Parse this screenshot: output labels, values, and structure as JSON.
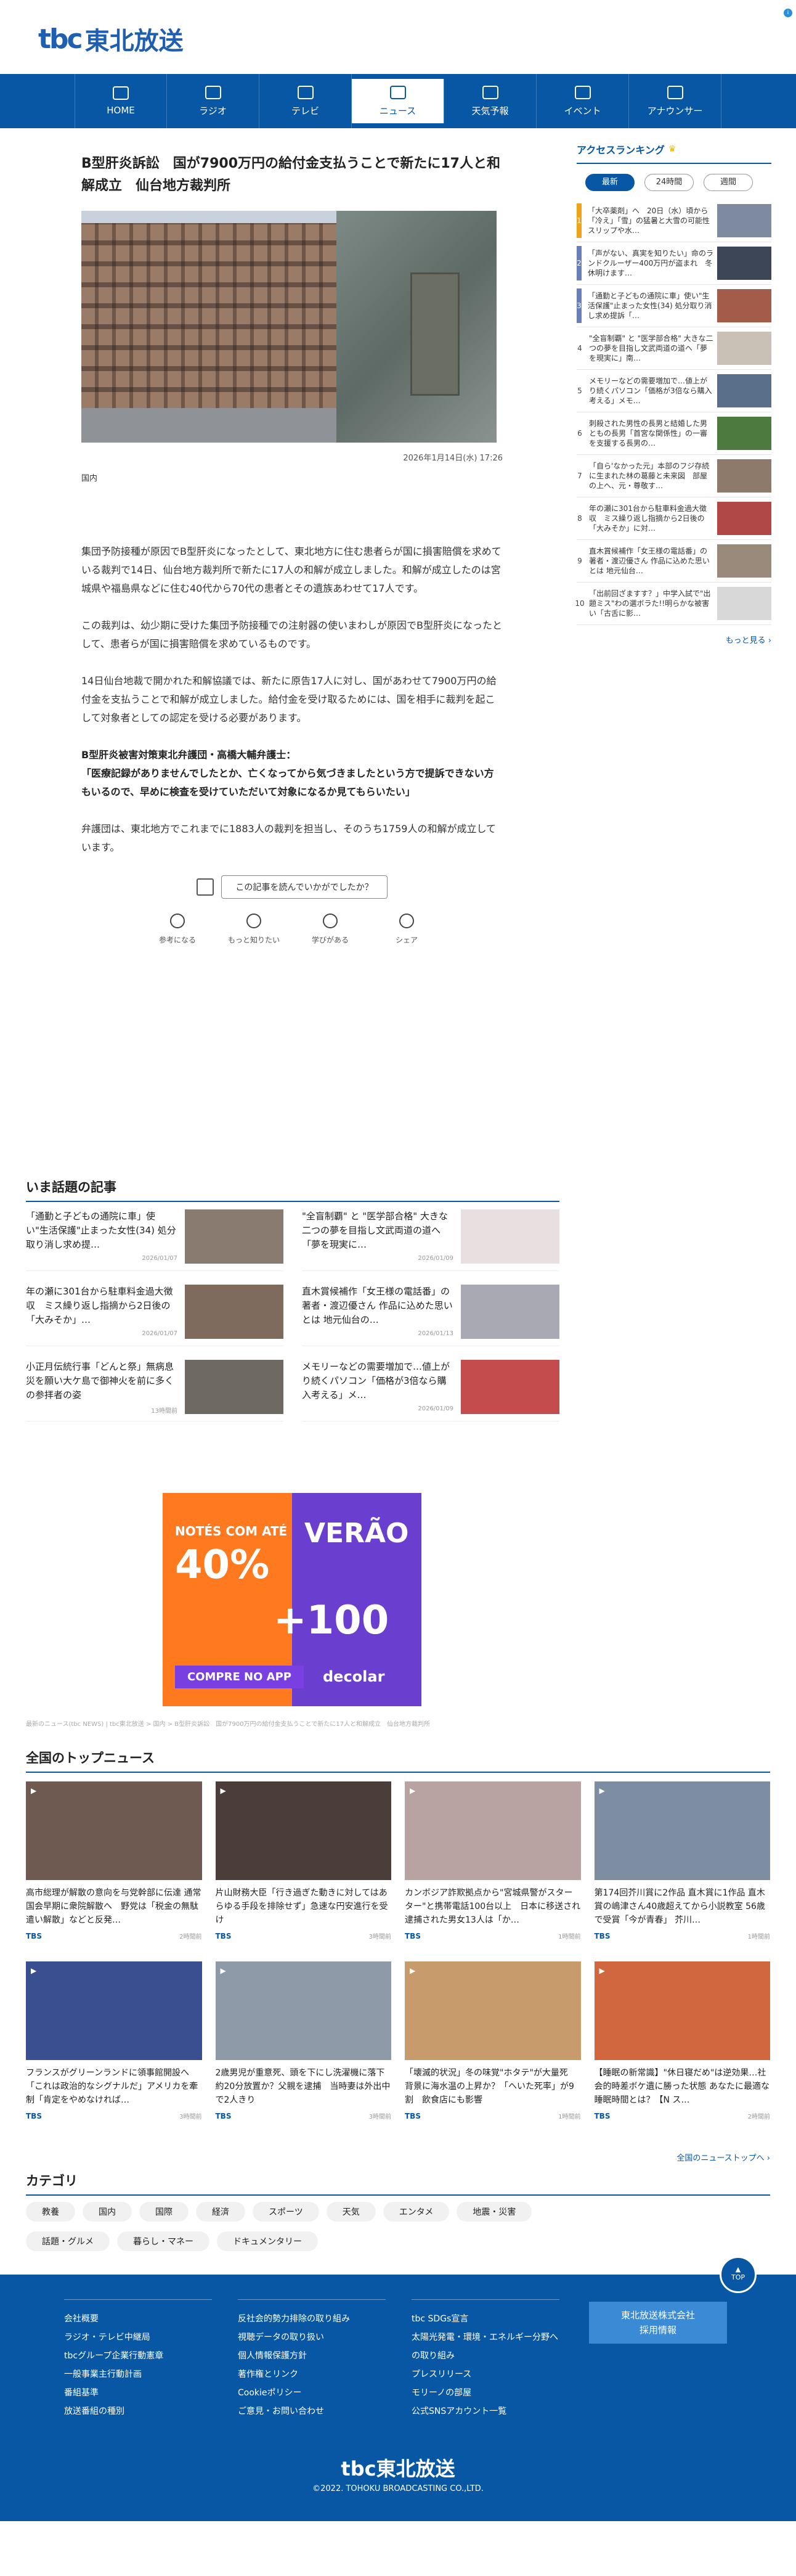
{
  "site": {
    "logo_mark": "tbc",
    "logo_text": "東北放送"
  },
  "nav": [
    {
      "label": "HOME",
      "icon": "home-icon",
      "active": false
    },
    {
      "label": "ラジオ",
      "icon": "radio-icon",
      "active": false
    },
    {
      "label": "テレビ",
      "icon": "tv-icon",
      "active": false
    },
    {
      "label": "ニュース",
      "icon": "news-icon",
      "active": true
    },
    {
      "label": "天気予報",
      "icon": "weather-icon",
      "active": false
    },
    {
      "label": "イベント",
      "icon": "event-icon",
      "active": false
    },
    {
      "label": "アナウンサー",
      "icon": "mic-icon",
      "active": false
    }
  ],
  "article": {
    "title": "B型肝炎訴訟　国が7900万円の給付金支払うことで新たに17人と和解成立　仙台地方裁判所",
    "date": "2026年1月14日(水) 17:26",
    "category": "国内",
    "paragraphs": [
      {
        "text": "集団予防接種が原因でB型肝炎になったとして、東北地方に住む患者らが国に損害賠償を求めている裁判で14日、仙台地方裁判所で新たに17人の和解が成立しました。和解が成立したのは宮城県や福島県などに住む40代から70代の患者とその遺族あわせて17人です。",
        "bold": false
      },
      {
        "text": "この裁判は、幼少期に受けた集団予防接種での注射器の使いまわしが原因でB型肝炎になったとして、患者らが国に損害賠償を求めているものです。",
        "bold": false
      },
      {
        "text": "14日仙台地裁で開かれた和解協議では、新たに原告17人に対し、国があわせて7900万円の給付金を支払うことで和解が成立しました。給付金を受け取るためには、国を相手に裁判を起こして対象者としての認定を受ける必要があります。",
        "bold": false
      },
      {
        "text": "B型肝炎被害対策東北弁護団・高橋大輔弁護士：\n「医療記録がありませんでしたとか、亡くなってから気づきましたという方で提訴できない方もいるので、早めに検査を受けていただいて対象になるか見てもらいたい」",
        "bold": true
      },
      {
        "text": "弁護団は、東北地方でこれまでに1883人の裁判を担当し、そのうち1759人の和解が成立しています。",
        "bold": false
      }
    ],
    "feedback_prompt": "この記事を読んでいかがでしたか？",
    "reactions": [
      "参考になる",
      "もっと知りたい",
      "学びがある",
      "シェア"
    ]
  },
  "ranking": {
    "title": "アクセスランキング",
    "tabs": [
      {
        "label": "最新",
        "active": true
      },
      {
        "label": "24時間",
        "active": false
      },
      {
        "label": "週間",
        "active": false
      }
    ],
    "items": [
      {
        "rank": "1",
        "text": "「大卒薬剤」へ　20日（水）頃から「冷え」「雪」の猛暑と大雪の可能性　スリップや水…"
      },
      {
        "rank": "2",
        "text": "「声がない、真実を知りたい」命のランドクルーザー400万円が盗まれ　冬休明けます…"
      },
      {
        "rank": "3",
        "text": "「通勤と子どもの通院に車」使い\"生活保護\"止まった女性(34) 処分取り消し求め提訴「…"
      },
      {
        "rank": "4",
        "text": "\"全盲制覇\" と \"医学部合格\" 大きな二つの夢を目指し文武両道の道へ「夢を現実に」南…"
      },
      {
        "rank": "5",
        "text": "メモリーなどの需要増加で…値上がり続くパソコン「価格が3倍なら購入考える」メモ…"
      },
      {
        "rank": "6",
        "text": "刺殺された男性の長男と結婚した男ともの長男「首宮な関係性」の一審を支援する長男の…"
      },
      {
        "rank": "7",
        "text": "「自ら'なかった元」本部のフジ存続に生まれた林の葛藤と未来図　部屋の上へ、元・尊敬す…"
      },
      {
        "rank": "8",
        "text": "年の瀬に301台から駐車料金過大徴収　ミス繰り返し指摘から2日後の「大みそか」に対…"
      },
      {
        "rank": "9",
        "text": "直木賞候補作「女王様の電話番」の著者・渡辺優さん 作品に込めた思いとは 地元仙台…"
      },
      {
        "rank": "10",
        "text": "「出前回ざますす？」中学入試で\"出題ミス\"わの選ボラた!!明らかな被害い「古舌に影…"
      }
    ],
    "more": "もっと見る ›"
  },
  "topics": {
    "title": "いま話題の記事",
    "items": [
      {
        "text": "「通勤と子どもの通院に車」使い\"生活保護\"止まった女性(34) 処分取り消し求め提…",
        "date": "2026/01/07"
      },
      {
        "text": "\"全盲制覇\" と \"医学部合格\" 大きな二つの夢を目指し文武両道の道へ「夢を現実に…",
        "date": "2026/01/09"
      },
      {
        "text": "年の瀬に301台から駐車料金過大徴収　ミス繰り返し指摘から2日後の「大みそか」…",
        "date": "2026/01/07"
      },
      {
        "text": "直木賞候補作「女王様の電話番」の著者・渡辺優さん 作品に込めた思いとは 地元仙台の…",
        "date": "2026/01/13"
      },
      {
        "text": "小正月伝統行事「どんと祭」無病息災を願い大ケ島で御神火を前に多くの参拝者の姿",
        "date": "13時間前"
      },
      {
        "text": "メモリーなどの需要増加で…値上がり続くパソコン「価格が3倍なら購入考える」メ…",
        "date": "2026/01/09"
      }
    ]
  },
  "ad": {
    "l1": "NOTÉS COM ATÉ",
    "l2": "40%",
    "l3": "VERÃO",
    "l4": "+100",
    "button": "COMPRE NO APP",
    "brand": "decolar"
  },
  "breadcrumb": "最新のニュース(tbc NEWS) | tbc東北放送 > 国内 > B型肝炎訴訟　国が7900万円の給付金支払うことで新たに17人と和解成立　仙台地方裁判所",
  "national": {
    "title": "全国のトップニュース",
    "items": [
      {
        "text": "高市総理が解散の意向を与党幹部に伝達 通常国会早期に衆院解散へ　野党は「税金の無駄遣い解散」などと反発…",
        "src": "TBS",
        "ago": "2時間前"
      },
      {
        "text": "片山財務大臣「行き過ぎた動きに対してはあらゆる手段を排除せず」急速な円安進行を受け",
        "src": "TBS",
        "ago": "3時間前"
      },
      {
        "text": "カンボジア詐欺拠点から\"宮城県警がスターター\"と携帯電話100台以上　日本に移送され逮捕された男女13人は「か…",
        "src": "TBS",
        "ago": "1時間前"
      },
      {
        "text": "第174回芥川賞に2作品 直木賞に1作品 直木賞の嶋津さん40歳超えてから小説教室 56歳で受賞「今が青春」 芥川…",
        "src": "TBS",
        "ago": "1時間前"
      },
      {
        "text": "フランスがグリーンランドに領事館開設へ「これは政治的なシグナルだ」アメリカを牽制「肯定をやめなければ…",
        "src": "TBS",
        "ago": "3時間前"
      },
      {
        "text": "2歳男児が重意死、頭を下にし洗濯機に落下　約20分放置か？父親を逮捕　当時妻は外出中で2人きり",
        "src": "TBS",
        "ago": "3時間前"
      },
      {
        "text": "「壊滅的状況」冬の味覚\"ホタテ\"が大量死　背景に海水温の上昇か？「ヘいた死率」が9割　飲食店にも影響",
        "src": "TBS",
        "ago": "1時間前"
      },
      {
        "text": "【睡眠の新常識】\"休日寝だめ\"は逆効果…社会的時差ボケ遺に勝った状態 あなたに最適な睡眠時間とは？【N ス…",
        "src": "TBS",
        "ago": "2時間前"
      }
    ],
    "more": "全国のニューストップへ ›"
  },
  "categories": {
    "title": "カテゴリ",
    "items": [
      "教養",
      "国内",
      "国際",
      "経済",
      "スポーツ",
      "天気",
      "エンタメ",
      "地震・災害",
      "話題・グルメ",
      "暮らし・マネー",
      "ドキュメンタリー"
    ]
  },
  "footer": {
    "top_label": "TOP",
    "col1": [
      "会社概要",
      "ラジオ・テレビ中継局",
      "tbcグループ企業行動憲章",
      "一般事業主行動計画",
      "番組基準",
      "放送番組の種別"
    ],
    "col2": [
      "反社会的勢力排除の取り組み",
      "視聴データの取り扱い",
      "個人情報保護方針",
      "著作権とリンク",
      "Cookieポリシー",
      "ご意見・お問い合わせ"
    ],
    "col3": [
      "tbc SDGs宣言",
      "太陽光発電・環境・エネルギー分野への取り組み",
      "プレスリリース",
      "モリーノの部屋",
      "公式SNSアカウント一覧"
    ],
    "recruit": "東北放送株式会社\n採用情報",
    "logo": "tbc東北放送",
    "copyright": "©2022. TOHOKU BROADCASTING CO.,LTD."
  }
}
